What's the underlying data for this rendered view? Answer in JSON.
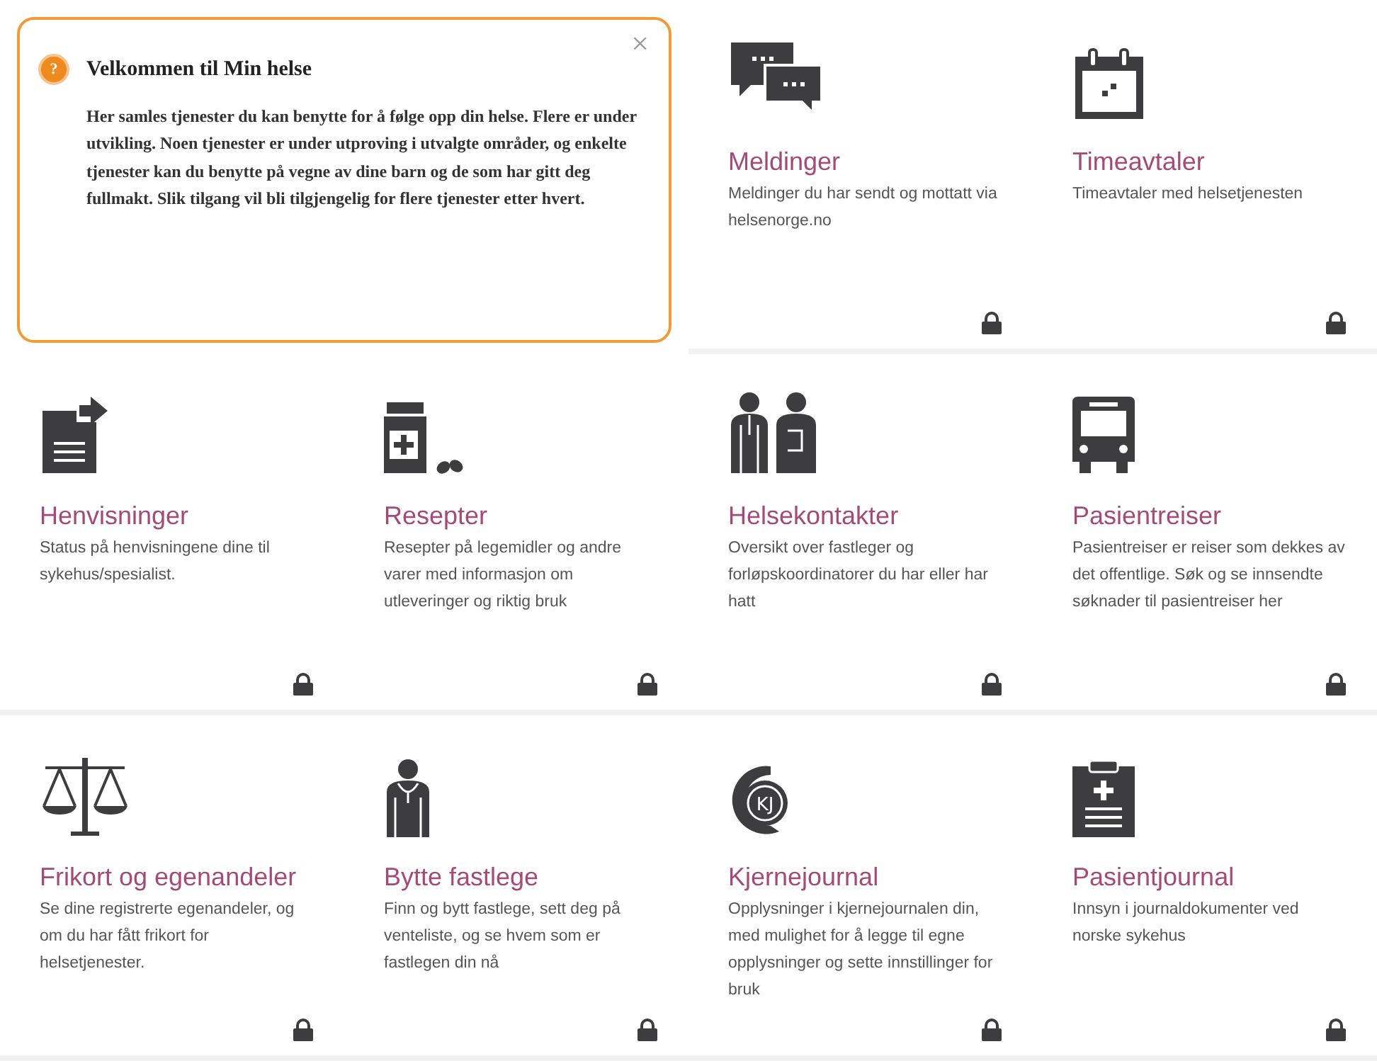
{
  "welcome": {
    "help_glyph": "?",
    "title": "Velkommen til Min helse",
    "close_glyph": "×",
    "text": "Her samles tjenester du kan benytte for å følge opp din helse. Flere er under utvikling. Noen tjenester er under utproving i utvalgte områder, og enkelte tjenester kan du benytte på vegne av dine barn og de som har gitt deg fullmakt. Slik tilgang vil bli tilgjengelig for flere tjenester etter hvert."
  },
  "tiles": [
    {
      "title": "Meldinger",
      "description": "Meldinger du har sendt og mottatt via helsenorge.no",
      "locked": true
    },
    {
      "title": "Timeavtaler",
      "description": "Timeavtaler med helsetjenesten",
      "locked": true
    },
    {
      "title": "Henvisninger",
      "description": "Status på henvisningene dine til sykehus/spesialist.",
      "locked": true
    },
    {
      "title": "Resepter",
      "description": "Resepter på legemidler og andre varer med informasjon om utleveringer og riktig bruk",
      "locked": true
    },
    {
      "title": "Helsekontakter",
      "description": "Oversikt over fastleger og forløpskoordinatorer du har eller har hatt",
      "locked": true
    },
    {
      "title": "Pasientreiser",
      "description": "Pasientreiser er reiser som dekkes av det offentlige. Søk og se innsendte søknader til pasientreiser her",
      "locked": true
    },
    {
      "title": "Frikort og egenandeler",
      "description": "Se dine registrerte egenandeler, og om du har fått frikort for helsetjenester.",
      "locked": true
    },
    {
      "title": "Bytte fastlege",
      "description": "Finn og bytt fastlege, sett deg på venteliste, og se hvem som er fastlegen din nå",
      "locked": true
    },
    {
      "title": "Kjernejournal",
      "description": "Opplysninger i kjernejournalen din, med mulighet for å legge til egne opplysninger og sette innstillinger for bruk",
      "locked": true,
      "icon_label": "KJ"
    },
    {
      "title": "Pasientjournal",
      "description": "Innsyn i journaldokumenter ved norske sykehus",
      "locked": true
    }
  ]
}
